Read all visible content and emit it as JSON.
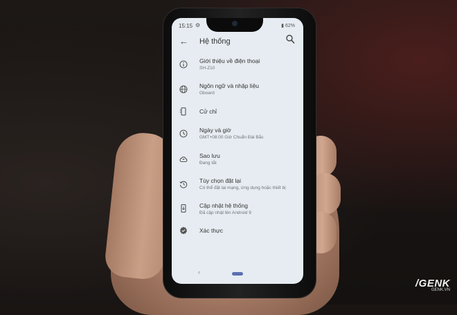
{
  "status_bar": {
    "time": "15:15",
    "battery": "62%"
  },
  "app_bar": {
    "title": "Hệ thống"
  },
  "settings_items": [
    {
      "title": "Giới thiệu về điện thoại",
      "subtitle": "SH-Z10",
      "icon": "info-icon"
    },
    {
      "title": "Ngôn ngữ và nhập liệu",
      "subtitle": "Gboard",
      "icon": "globe-icon"
    },
    {
      "title": "Cử chỉ",
      "subtitle": "",
      "icon": "gesture-phone-icon"
    },
    {
      "title": "Ngày và giờ",
      "subtitle": "GMT+08:00 Giờ Chuẩn Đài Bắc",
      "icon": "clock-icon"
    },
    {
      "title": "Sao lưu",
      "subtitle": "Đang tắt",
      "icon": "cloud-upload-icon"
    },
    {
      "title": "Tùy chọn đặt lại",
      "subtitle": "Có thể đặt lại mạng, ứng dụng hoặc thiết bị",
      "icon": "history-icon"
    },
    {
      "title": "Cập nhật hệ thống",
      "subtitle": "Đã cập nhật lên Android 9",
      "icon": "system-update-icon"
    },
    {
      "title": "Xác thực",
      "subtitle": "",
      "icon": "verified-badge-icon"
    }
  ],
  "watermark": {
    "brand": "GENK",
    "url": "GENK.VN"
  },
  "colors": {
    "screen_bg": "#e6ecf1",
    "text_primary": "#333333",
    "text_secondary": "#6f7378",
    "nav_home": "#5d6fb3"
  }
}
